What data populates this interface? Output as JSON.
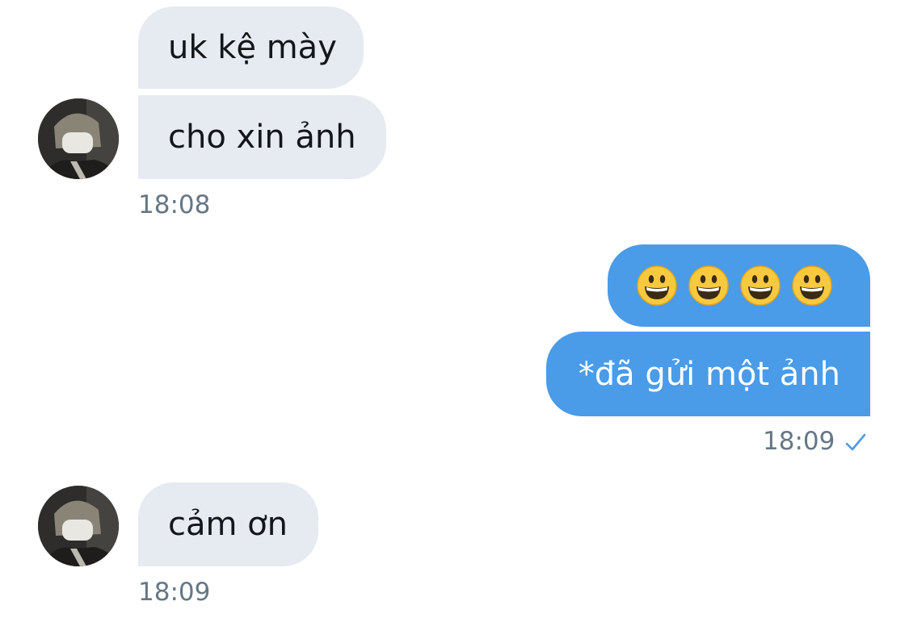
{
  "conversation": {
    "messages": [
      {
        "text": "uk kệ mày",
        "sender": "contact"
      },
      {
        "text": "cho xin ảnh",
        "sender": "contact"
      },
      {
        "text": "*đã gửi một ảnh",
        "sender": "me"
      },
      {
        "text": "cảm ơn",
        "sender": "contact"
      }
    ],
    "emoji_message": {
      "icons": [
        "grinning-face-icon",
        "grinning-face-icon",
        "grinning-face-icon",
        "grinning-face-icon"
      ],
      "sender": "me"
    },
    "timestamps": {
      "group1": "18:08",
      "group2": "18:09",
      "group3": "18:09"
    },
    "read_status_icon": "check-icon"
  },
  "colors": {
    "incoming_bubble": "#e6eaf1",
    "outgoing_bubble": "#4a9be8",
    "timestamp": "#657786",
    "check": "#4a9be8"
  }
}
